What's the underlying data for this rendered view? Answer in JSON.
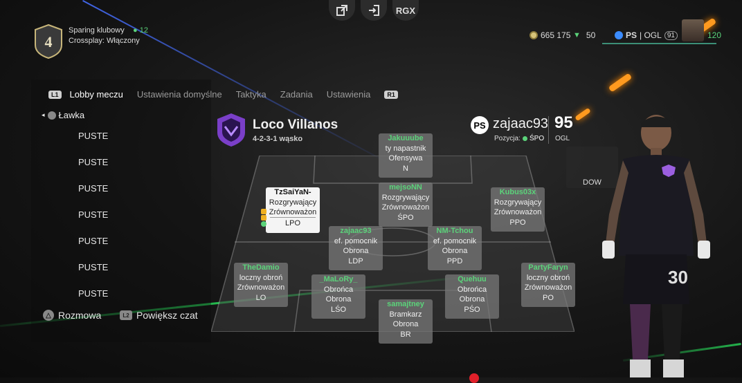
{
  "top_buttons": {
    "share_icon": "share-icon",
    "exit_icon": "exit-icon",
    "rgx": "RGX"
  },
  "header": {
    "rank": "4",
    "title": "Sparing klubowy",
    "member_count": "12",
    "crossplay": "Crossplay: Włączony",
    "coins": "665 175",
    "points": "50",
    "platform": "PS",
    "ogl_label": "| OGL",
    "ogl_value": "91",
    "level": "120"
  },
  "tabs": {
    "l1": "L1",
    "r1": "R1",
    "items": [
      "Lobby meczu",
      "Ustawienia domyślne",
      "Taktyka",
      "Zadania",
      "Ustawienia"
    ]
  },
  "bench": {
    "title": "Ławka",
    "slots": [
      "PUSTE",
      "PUSTE",
      "PUSTE",
      "PUSTE",
      "PUSTE",
      "PUSTE",
      "PUSTE"
    ]
  },
  "footer": {
    "chat": "Rozmowa",
    "zoom": "Powiększ czat",
    "chat_btn": "△",
    "zoom_btn": "L2"
  },
  "club": {
    "name": "Loco Villanos",
    "formation": "4-2-3-1 wąsko"
  },
  "user": {
    "psn": "PS",
    "name": "zajaac93",
    "rating": "95",
    "pos_label": "Pozycja:",
    "pos_value": "ŚPO",
    "rating_label": "OGL"
  },
  "players": [
    {
      "name": "Jakuuube",
      "r1": "ty napastnik",
      "r2": "Ofensywa",
      "pos": "N"
    },
    {
      "name": "mejsoNN",
      "r1": "Rozgrywający",
      "r2": "Zrównoważon",
      "pos": "ŚPO"
    },
    {
      "name": "TzSaiYaN-",
      "r1": "Rozgrywający",
      "r2": "Zrównoważon",
      "pos": "LPO"
    },
    {
      "name": "Kubus03x",
      "r1": "Rozgrywający",
      "r2": "Zrównoważon",
      "pos": "PPO"
    },
    {
      "name": "zajaac93",
      "r1": "ef. pomocnik",
      "r2": "Obrona",
      "pos": "LDP"
    },
    {
      "name": "NM-Tchou",
      "r1": "ef. pomocnik",
      "r2": "Obrona",
      "pos": "PPD"
    },
    {
      "name": "TheDamio",
      "r1": "loczny obroń",
      "r2": "Zrównoważon",
      "pos": "LO"
    },
    {
      "name": "_MaLoRy_",
      "r1": "Obrońca",
      "r2": "Obrona",
      "pos": "LŚO"
    },
    {
      "name": "Quehuu",
      "r1": "Obrońca",
      "r2": "Obrona",
      "pos": "PŚO"
    },
    {
      "name": "PartyFaryn",
      "r1": "loczny obroń",
      "r2": "Zrównoważon",
      "pos": "PO"
    },
    {
      "name": "samajtney",
      "r1": "Bramkarz",
      "r2": "Obrona",
      "pos": "BR"
    }
  ],
  "right_panel": {
    "dow": "DOW",
    "shirt_number": "30"
  },
  "colors": {
    "accent_green": "#5bd37a",
    "club_purple": "#7a3fc8",
    "orange": "#ff9a1f"
  }
}
